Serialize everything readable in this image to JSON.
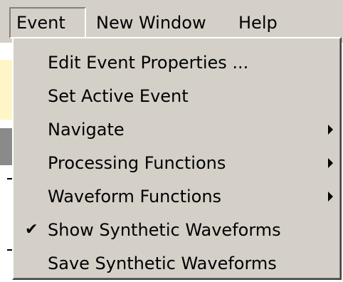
{
  "menubar": {
    "items": [
      {
        "label": "Event"
      },
      {
        "label": "New Window"
      },
      {
        "label": "Help"
      }
    ]
  },
  "event_menu": {
    "items": [
      {
        "label": "Edit Event Properties ...",
        "has_submenu": false,
        "checked": false
      },
      {
        "label": "Set Active Event",
        "has_submenu": false,
        "checked": false
      },
      {
        "label": "Navigate",
        "has_submenu": true,
        "checked": false
      },
      {
        "label": "Processing Functions",
        "has_submenu": true,
        "checked": false
      },
      {
        "label": "Waveform Functions",
        "has_submenu": true,
        "checked": false
      },
      {
        "label": "Show Synthetic Waveforms",
        "has_submenu": false,
        "checked": true
      },
      {
        "label": "Save Synthetic Waveforms",
        "has_submenu": false,
        "checked": false
      }
    ],
    "check_glyph": "✔",
    "icons": {
      "submenu": "submenu-arrow-icon",
      "check": "checkmark-icon"
    }
  }
}
